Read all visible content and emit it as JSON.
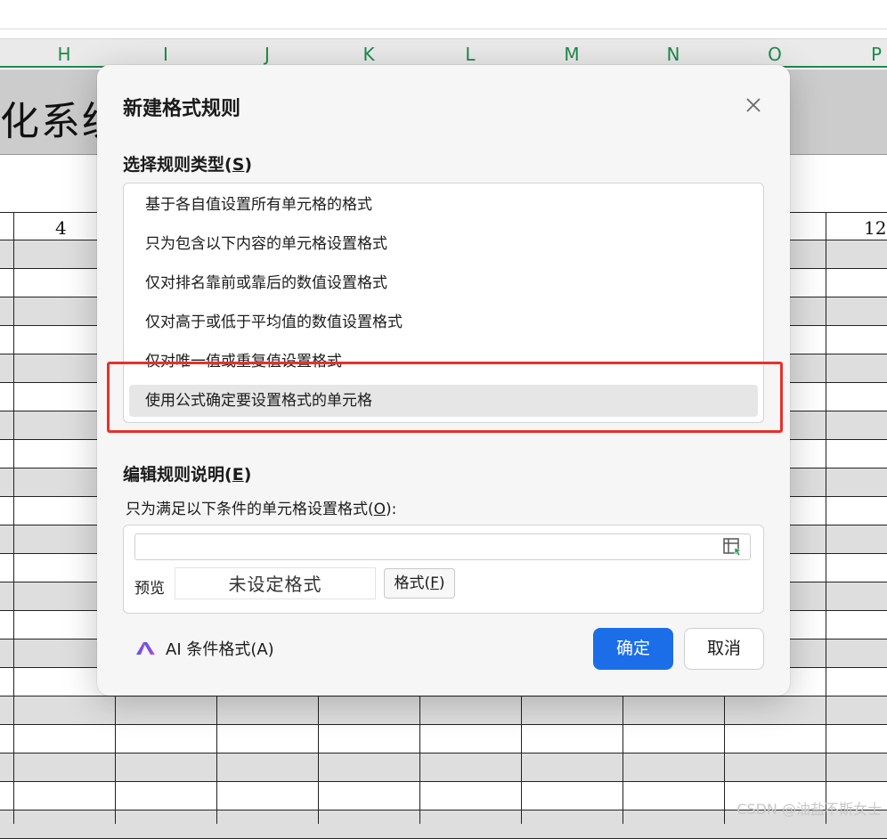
{
  "sheet": {
    "columns": [
      "H",
      "I",
      "J",
      "K",
      "L",
      "M",
      "N",
      "O",
      "P"
    ],
    "title_fragment": "化系统",
    "cell_left_value": "4",
    "cell_right_value": "12",
    "watermark": "CSDN @油盐不斯女士"
  },
  "dialog": {
    "title": "新建格式规则",
    "select_type_label": "选择规则类型",
    "select_type_key": "S",
    "rule_types": [
      {
        "label": "基于各自值设置所有单元格的格式",
        "selected": false
      },
      {
        "label": "只为包含以下内容的单元格设置格式",
        "selected": false
      },
      {
        "label": "仅对排名靠前或靠后的数值设置格式",
        "selected": false
      },
      {
        "label": "仅对高于或低于平均值的数值设置格式",
        "selected": false
      },
      {
        "label": "仅对唯一值或重复值设置格式",
        "selected": false
      },
      {
        "label": "使用公式确定要设置格式的单元格",
        "selected": true
      }
    ],
    "edit_desc_label": "编辑规则说明",
    "edit_desc_key": "E",
    "condition_label": "只为满足以下条件的单元格设置格式",
    "condition_key": "O",
    "formula_value": "",
    "preview_label": "预览",
    "preview_text": "未设定格式",
    "format_button": "格式",
    "format_key": "F",
    "ai_button": "AI 条件格式(A)",
    "ok_button": "确定",
    "cancel_button": "取消"
  },
  "colors": {
    "accent": "#1b6ee8",
    "column_header_text": "#1e8a4c",
    "highlight_annotation": "#e8302a"
  }
}
